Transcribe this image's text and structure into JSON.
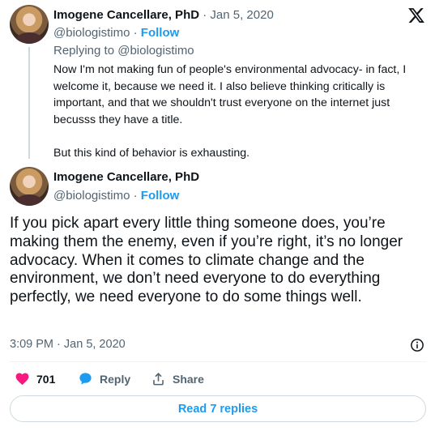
{
  "brand": {
    "logo_icon": "x-logo-icon"
  },
  "parent_tweet": {
    "author_name": "Imogene Cancellare, PhD",
    "date": "Jan 5, 2020",
    "separator": "·",
    "handle": "@biologistimo",
    "follow_label": "Follow",
    "replying_prefix": "Replying to",
    "replying_handle": "@biologistimo",
    "body": [
      "Now I'm not making fun of people's environmental advocacy- in fact, I welcome it, because we need it. I also believe thinking critically is important, and that we shouldn't trust everyone on the internet just becusss they have a title.",
      "But this kind of behavior is exhausting."
    ]
  },
  "main_tweet": {
    "author_name": "Imogene Cancellare, PhD",
    "handle": "@biologistimo",
    "separator": "·",
    "follow_label": "Follow",
    "body": "If you pick apart every little thing someone does, you’re making them the enemy, even if you’re right, it’s no longer advocacy. When it comes to climate change and the environment, we don’t need everyone to do everything perfectly, we need everyone to do some things well.",
    "time": "3:09 PM",
    "date": "Jan 5, 2020",
    "info_icon": "info-icon"
  },
  "actions": {
    "like_count": "701",
    "reply_label": "Reply",
    "share_label": "Share"
  },
  "read_replies_label": "Read 7 replies",
  "colors": {
    "accent": "#1d9bf0",
    "like": "#f91880",
    "text": "#0f1419",
    "muted": "#536471"
  }
}
